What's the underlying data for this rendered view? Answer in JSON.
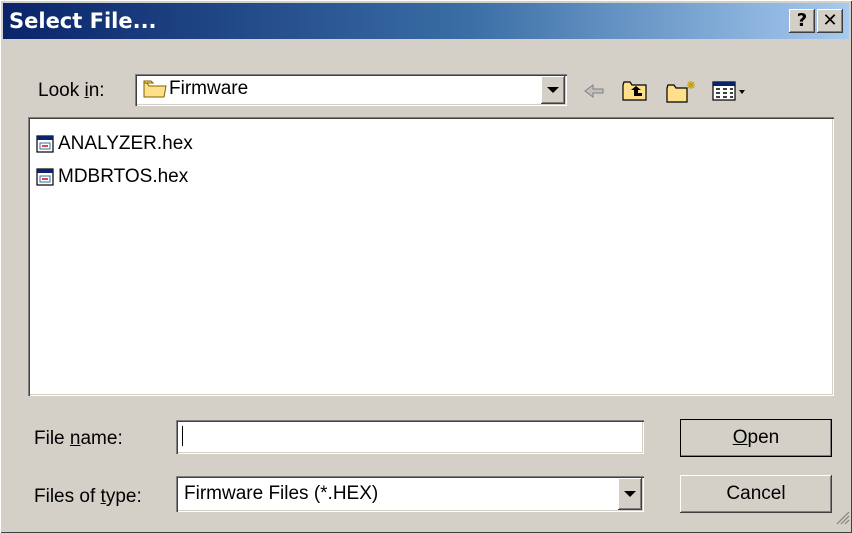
{
  "window": {
    "title": "Select File...",
    "help_label": "?",
    "close_label": "✕"
  },
  "toolbar": {
    "look_in_prefix": "Look ",
    "look_in_hotkey": "i",
    "look_in_suffix": "n:",
    "look_in_value": "Firmware",
    "icons": [
      "back-arrow-icon",
      "up-folder-icon",
      "new-folder-icon",
      "view-menu-icon"
    ]
  },
  "files": [
    {
      "name": "ANALYZER.hex",
      "icon": "hex-file-icon"
    },
    {
      "name": "MDBRTOS.hex",
      "icon": "hex-file-icon"
    }
  ],
  "file_name": {
    "label_prefix": "File ",
    "label_hotkey": "n",
    "label_suffix": "ame:",
    "value": ""
  },
  "file_type": {
    "label_prefix": "Files of ",
    "label_hotkey": "t",
    "label_suffix": "ype:",
    "value": "Firmware Files (*.HEX)"
  },
  "buttons": {
    "open_hotkey": "O",
    "open_rest": "pen",
    "cancel": "Cancel"
  },
  "colors": {
    "titlebar_start": "#0a246a",
    "titlebar_end": "#a6caf0",
    "face": "#d4d0c8"
  }
}
